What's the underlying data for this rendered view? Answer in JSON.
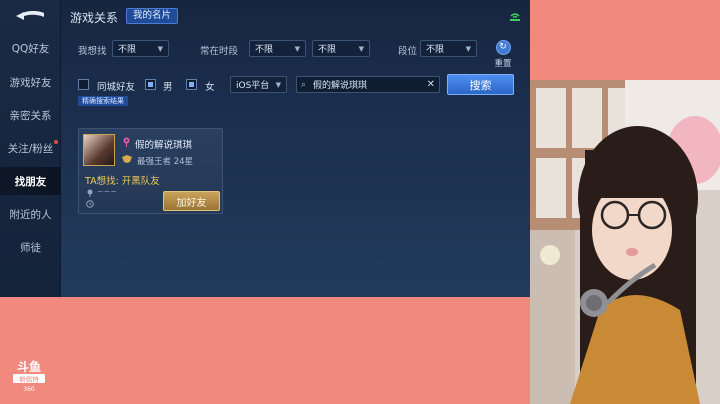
{
  "sidebar": {
    "items": [
      {
        "label": "QQ好友"
      },
      {
        "label": "游戏好友"
      },
      {
        "label": "亲密关系"
      },
      {
        "label": "关注/粉丝"
      },
      {
        "label": "找朋友"
      },
      {
        "label": "附近的人"
      },
      {
        "label": "师徒"
      }
    ]
  },
  "header": {
    "title": "游戏关系",
    "tab": "我的名片"
  },
  "filters": {
    "want_label": "我想找",
    "want_value": "不限",
    "time_label": "常在时段",
    "time_from": "不限",
    "time_to": "不限",
    "rank_label": "段位",
    "rank_value": "不限",
    "reset_label": "重置"
  },
  "options": {
    "same_city": "同城好友",
    "male": "男",
    "female": "女",
    "platform": "iOS平台",
    "search_value": "假的解说琪琪",
    "search_button": "搜索",
    "precise_tag": "精确搜索结果"
  },
  "result": {
    "name": "假的解说琪琪",
    "rank": "最强王者 24星",
    "wants": "TA想找: 开黑队友",
    "location": "~~~",
    "add_button": "加好友"
  },
  "watermark": {
    "line1": "斗鱼",
    "line2": "斯佩特",
    "line3": "360"
  }
}
